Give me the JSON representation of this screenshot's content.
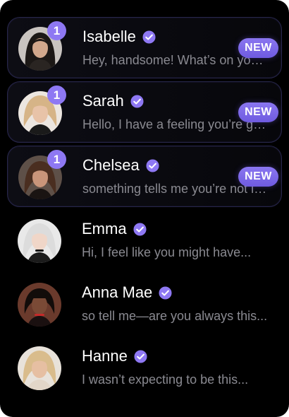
{
  "colors": {
    "accent": "#8e78f3",
    "background": "#000000",
    "name_text": "#ffffff",
    "preview_text": "#8a8a91"
  },
  "chats": [
    {
      "name": "Isabelle",
      "preview": "Hey, handsome! What’s on your mind?",
      "unread_count": "1",
      "badge": "NEW",
      "verified": true
    },
    {
      "name": "Sarah",
      "preview": "Hello, I have a feeling you’re going to",
      "unread_count": "1",
      "badge": "NEW",
      "verified": true
    },
    {
      "name": "Chelsea",
      "preview": "something tells me you’re not like the others",
      "unread_count": "1",
      "badge": "NEW",
      "verified": true
    },
    {
      "name": "Emma",
      "preview": "Hi, I feel like you might have...",
      "verified": true
    },
    {
      "name": "Anna Mae",
      "preview": "so tell me—are you always this...",
      "verified": true
    },
    {
      "name": "Hanne",
      "preview": "I wasn’t expecting to be this...",
      "verified": true
    }
  ]
}
